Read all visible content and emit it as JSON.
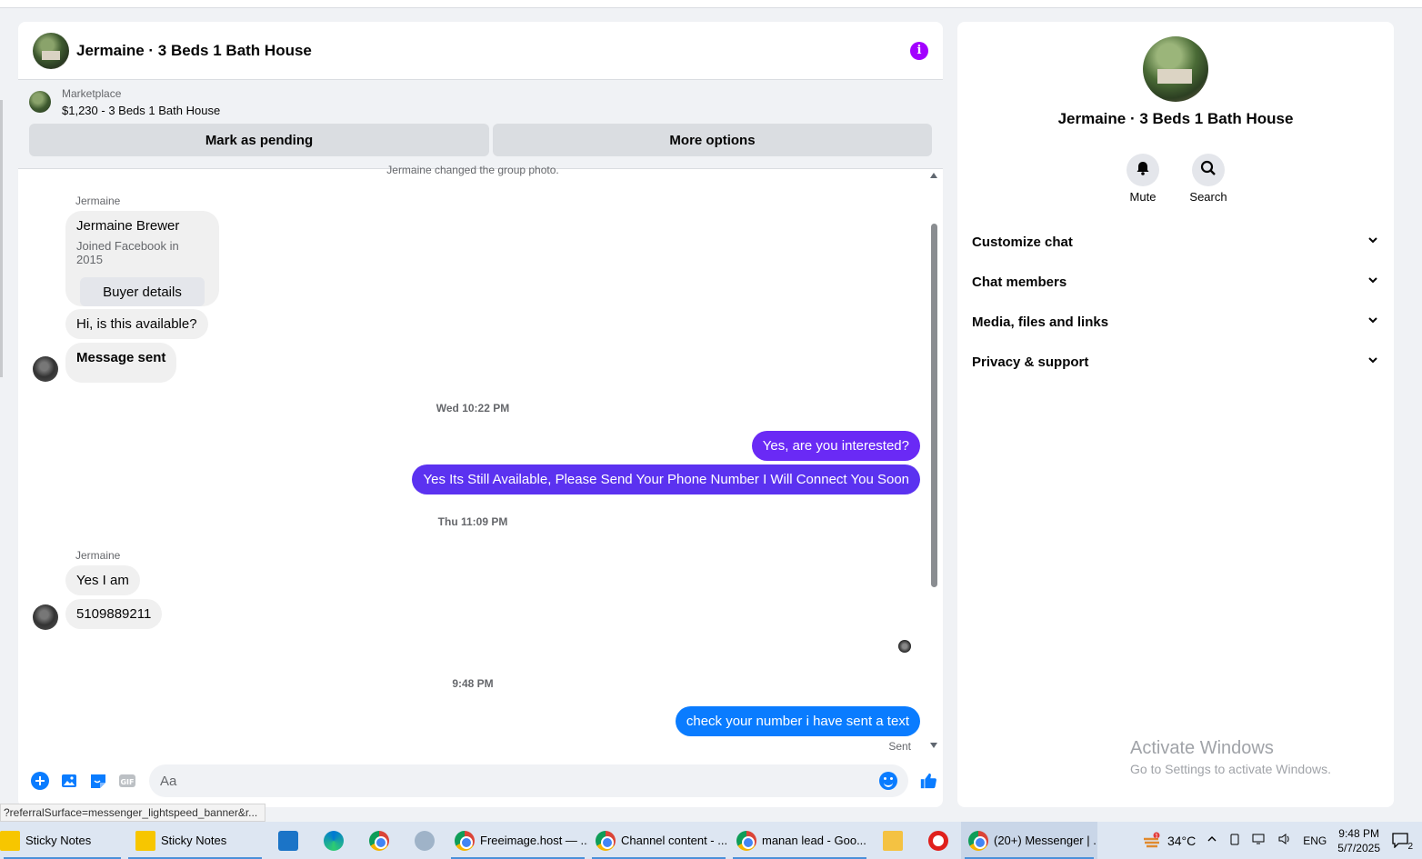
{
  "chat": {
    "title": "Jermaine · 3 Beds 1 Bath House",
    "marketplace_label": "Marketplace",
    "listing": "$1,230 - 3 Beds 1 Bath House",
    "mark_pending": "Mark as pending",
    "more_options": "More options",
    "system_note": "Jermaine changed the group photo.",
    "card": {
      "sender": "Jermaine",
      "name": "Jermaine Brewer",
      "joined": "Joined Facebook in 2015",
      "button": "Buyer details"
    },
    "messages": {
      "m1": "Hi, is this available?",
      "m2": "Message sent",
      "ts1": "Wed 10:22 PM",
      "m3": "Yes, are you interested?",
      "m4": "Yes Its Still Available, Please Send Your Phone Number I Will Connect You Soon",
      "ts2": "Thu 11:09 PM",
      "sender2": "Jermaine",
      "m5": "Yes I am",
      "m6": "5109889211",
      "ts3": "9:48 PM",
      "m7": "check your number i have sent a text",
      "status": "Sent"
    },
    "composer_placeholder": "Aa",
    "gif_label": "GIF"
  },
  "info_panel": {
    "name": "Jermaine · 3 Beds 1 Bath House",
    "mute": "Mute",
    "search": "Search",
    "sections": [
      "Customize chat",
      "Chat members",
      "Media, files and links",
      "Privacy & support"
    ]
  },
  "watermark": {
    "title": "Activate Windows",
    "subtitle": "Go to Settings to activate Windows."
  },
  "status_url": "?referralSurface=messenger_lightspeed_banner&r...",
  "taskbar": {
    "items": [
      "Sticky Notes",
      "Sticky Notes",
      "Freeimage.host — ...",
      "Channel content - ...",
      "manan lead - Goo...",
      "(20+) Messenger | ..."
    ],
    "temperature": "34°C",
    "language": "ENG",
    "time": "9:48 PM",
    "date": "5/7/2025",
    "notification_count": "2",
    "weather_badge": "1"
  },
  "colors": {
    "accent_purple": "#a200ff",
    "out_bubble_1": "#6a2af5",
    "out_bubble_2": "#5b32f0",
    "out_bubble_3": "#0a7cff",
    "messenger_blue": "#0a7cff"
  },
  "icons": [
    "info-icon",
    "plus-icon",
    "image-icon",
    "sticker-icon",
    "gif-icon",
    "emoji-icon",
    "like-icon",
    "bell-icon",
    "search-icon",
    "chevron-down-icon"
  ]
}
